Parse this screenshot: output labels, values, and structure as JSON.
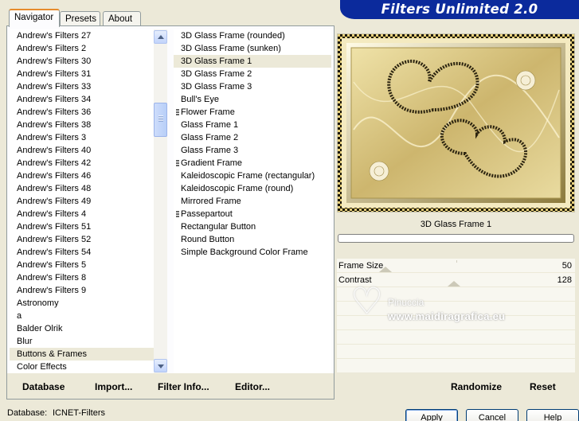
{
  "tabs": [
    "Navigator",
    "Presets",
    "About"
  ],
  "brand": "Filters Unlimited 2.0",
  "categories": [
    "Andrew's Filters 27",
    "Andrew's Filters 2",
    "Andrew's Filters 30",
    "Andrew's Filters 31",
    "Andrew's Filters 33",
    "Andrew's Filters 34",
    "Andrew's Filters 36",
    "Andrew's Filters 38",
    "Andrew's Filters 3",
    "Andrew's Filters 40",
    "Andrew's Filters 42",
    "Andrew's Filters 46",
    "Andrew's Filters 48",
    "Andrew's Filters 49",
    "Andrew's Filters 4",
    "Andrew's Filters 51",
    "Andrew's Filters 52",
    "Andrew's Filters 54",
    "Andrew's Filters 5",
    "Andrew's Filters 8",
    "Andrew's Filters 9",
    "Astronomy",
    "a",
    "Balder Olrik",
    "Blur",
    "Buttons & Frames",
    "Color Effects"
  ],
  "selected_category": "Buttons & Frames",
  "filters": [
    {
      "label": "3D Glass Frame (rounded)",
      "group": false
    },
    {
      "label": "3D Glass Frame (sunken)",
      "group": false
    },
    {
      "label": "3D Glass Frame 1",
      "group": false
    },
    {
      "label": "3D Glass Frame 2",
      "group": false
    },
    {
      "label": "3D Glass Frame 3",
      "group": false
    },
    {
      "label": "Bull's Eye",
      "group": false
    },
    {
      "label": "Flower Frame",
      "group": true
    },
    {
      "label": "Glass Frame 1",
      "group": false
    },
    {
      "label": "Glass Frame 2",
      "group": false
    },
    {
      "label": "Glass Frame 3",
      "group": false
    },
    {
      "label": "Gradient Frame",
      "group": true
    },
    {
      "label": "Kaleidoscopic Frame (rectangular)",
      "group": false
    },
    {
      "label": "Kaleidoscopic Frame (round)",
      "group": false
    },
    {
      "label": "Mirrored Frame",
      "group": false
    },
    {
      "label": "Passepartout",
      "group": true
    },
    {
      "label": "Rectangular Button",
      "group": false
    },
    {
      "label": "Round Button",
      "group": false
    },
    {
      "label": "Simple Background Color Frame",
      "group": false
    }
  ],
  "selected_filter": "3D Glass Frame 1",
  "preview": {
    "filter_name": "3D Glass Frame 1",
    "progress": 0
  },
  "params": [
    {
      "label": "Frame Size",
      "value": "50",
      "level": 0.196
    },
    {
      "label": "Contrast",
      "value": "128",
      "level": 0.502
    }
  ],
  "watermark": {
    "line1": "Pinuccia",
    "line2": "www.maidiragrafica.eu"
  },
  "left_actions": [
    "Database",
    "Import...",
    "Filter Info...",
    "Editor..."
  ],
  "right_actions": [
    "Randomize",
    "Reset"
  ],
  "status": {
    "database_label": "Database:",
    "database_value": "ICNET-Filters"
  },
  "buttons": [
    "Apply",
    "Cancel",
    "Help"
  ]
}
